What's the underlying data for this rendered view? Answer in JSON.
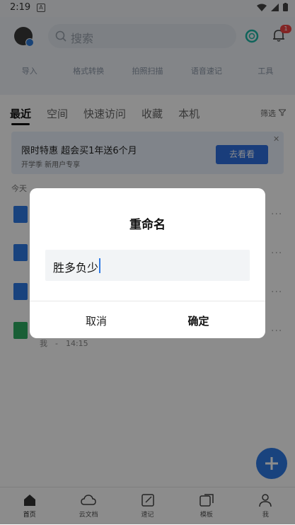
{
  "status_bar": {
    "time": "2:19",
    "a_icon": "A"
  },
  "header": {
    "search_placeholder": "搜索",
    "notification_count": "1",
    "tools": [
      "导入",
      "格式转换",
      "拍照扫描",
      "语音速记",
      "工具"
    ]
  },
  "tabs": [
    {
      "label": "最近",
      "active": true
    },
    {
      "label": "空间",
      "active": false
    },
    {
      "label": "快速访问",
      "active": false
    },
    {
      "label": "收藏",
      "active": false
    },
    {
      "label": "本机",
      "active": false
    }
  ],
  "filter_label": "筛选",
  "promo": {
    "title": "限时特惠 超会买1年送6个月",
    "subtitle": "开学季 新用户专享",
    "button": "去看看"
  },
  "list": {
    "section": "今天",
    "last_meta": "我　-　14:15"
  },
  "bottom_nav": [
    {
      "label": "首页",
      "icon": "home-icon",
      "active": true
    },
    {
      "label": "云文档",
      "icon": "cloud-icon",
      "active": false
    },
    {
      "label": "速记",
      "icon": "note-icon",
      "active": false
    },
    {
      "label": "模板",
      "icon": "template-icon",
      "active": false
    },
    {
      "label": "我",
      "icon": "person-icon",
      "active": false
    }
  ],
  "dialog": {
    "title": "重命名",
    "input_value": "胜多负少",
    "cancel": "取消",
    "confirm": "确定"
  },
  "colors": {
    "accent": "#2f7ae5",
    "promo_button": "#2f6fe0",
    "sheet_icon": "#2eae63"
  }
}
